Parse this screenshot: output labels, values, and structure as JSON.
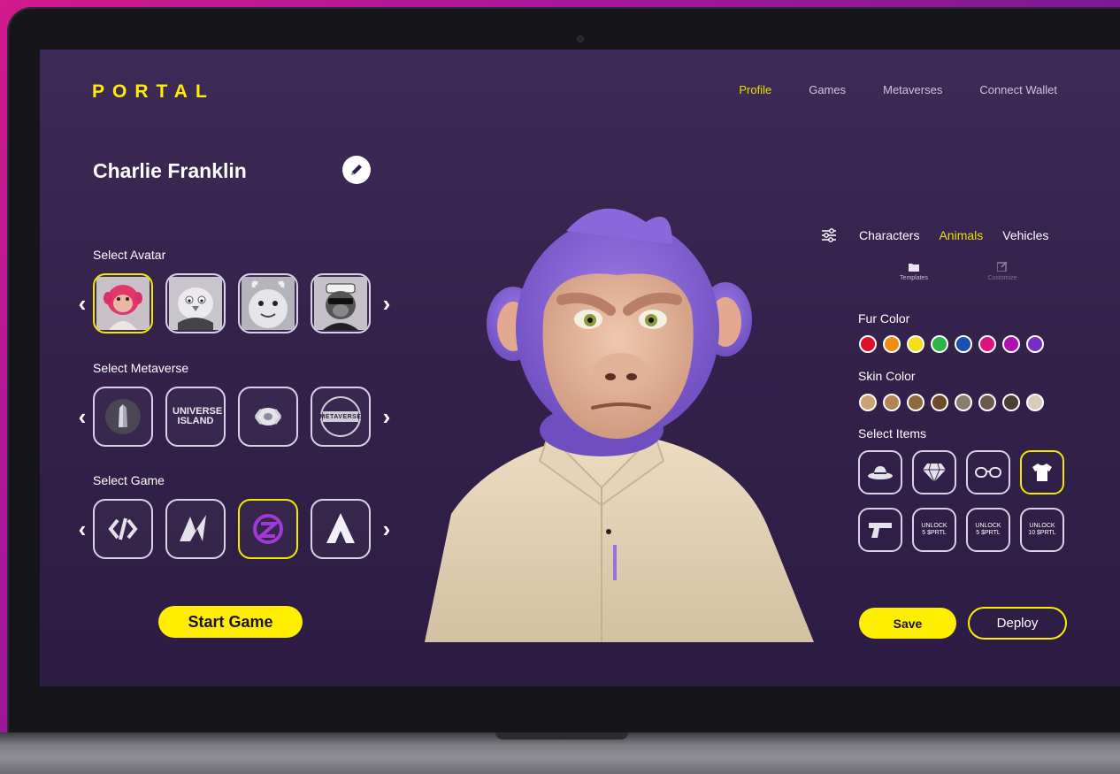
{
  "app": {
    "logo": "PORTAL"
  },
  "nav": {
    "items": [
      {
        "label": "Profile",
        "active": true
      },
      {
        "label": "Games",
        "active": false
      },
      {
        "label": "Metaverses",
        "active": false
      },
      {
        "label": "Connect Wallet",
        "active": false
      }
    ]
  },
  "profile": {
    "name": "Charlie Franklin",
    "edit_icon": "pencil-icon"
  },
  "avatars": {
    "label": "Select Avatar",
    "selected_index": 0,
    "items": [
      "pink-ape-avatar",
      "gray-bird-avatar",
      "gray-monster-avatar",
      "ape-sailor-avatar"
    ]
  },
  "metaverses": {
    "label": "Select Metaverse",
    "items": [
      {
        "name": "dark-spire-logo",
        "text": ""
      },
      {
        "name": "universe-island-logo",
        "text": "UNIVERSE ISLAND"
      },
      {
        "name": "white-sphere-logo",
        "text": ""
      },
      {
        "name": "metaverse-crest-logo",
        "text": "METAVERSE"
      }
    ]
  },
  "games": {
    "label": "Select Game",
    "selected_index": 2,
    "items": [
      "code-bracket-game-icon",
      "lightning-m-game-icon",
      "circle-z-game-icon",
      "arrow-a-game-icon"
    ]
  },
  "start_button": "Start Game",
  "right_panel": {
    "filter_icon": "sliders-icon",
    "tabs": [
      {
        "label": "Characters",
        "active": false
      },
      {
        "label": "Animals",
        "active": true
      },
      {
        "label": "Vehicles",
        "active": false
      }
    ],
    "subtabs": [
      {
        "label": "Templates",
        "icon": "folder-icon"
      },
      {
        "label": "Customize",
        "icon": "edit-square-icon"
      }
    ],
    "fur_label": "Fur Color",
    "fur_colors": [
      "#e0102a",
      "#f08c12",
      "#f4e010",
      "#2eb448",
      "#1a4fb4",
      "#e0107e",
      "#b010b0",
      "#7a2cc6"
    ],
    "skin_label": "Skin Color",
    "skin_colors": [
      "#c9a46e",
      "#b08453",
      "#8c6a3c",
      "#6e4a26",
      "#8a7c6e",
      "#6a5a4e",
      "#4a3e36",
      "#d9cbb6"
    ],
    "items_label": "Select Items",
    "items_row1": [
      "hat-icon",
      "diamond-icon",
      "glasses-icon",
      "tshirt-icon"
    ],
    "items_row2": [
      {
        "icon": "gun-icon",
        "text": ""
      },
      {
        "icon": "",
        "text": "UNLOCK\n5 $PRTL"
      },
      {
        "icon": "",
        "text": "UNLOCK\n5 $PRTL"
      },
      {
        "icon": "",
        "text": "UNLOCK\n10 $PRTL"
      }
    ],
    "selected_item": "tshirt-icon"
  },
  "save_button": "Save",
  "deploy_button": "Deploy"
}
